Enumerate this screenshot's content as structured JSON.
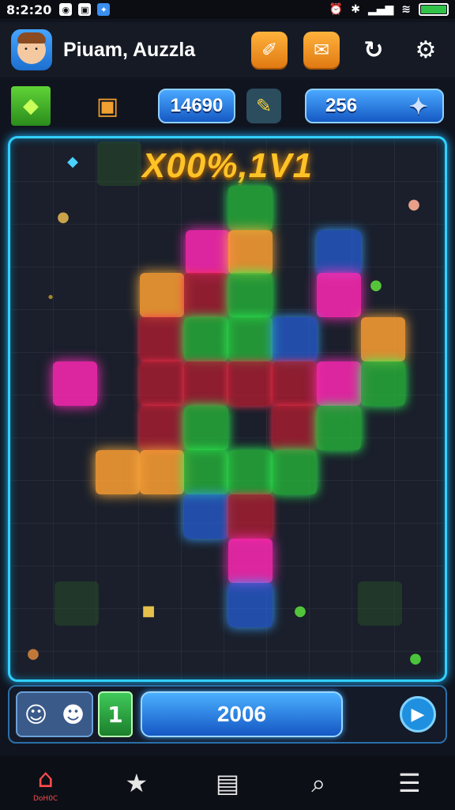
{
  "status_bar": {
    "time": "8:2:20",
    "icons": [
      "notification-icon",
      "image-icon",
      "app-icon"
    ],
    "right_icons": [
      "alarm-icon",
      "bluetooth-icon",
      "signal-icon",
      "wifi-icon",
      "battery-icon"
    ]
  },
  "header": {
    "title": "Piuam, Auzzla",
    "avatar_icon": "player-avatar",
    "buttons": [
      {
        "name": "hammer-icon",
        "glyph": "✐"
      },
      {
        "name": "mail-icon",
        "glyph": "✉"
      },
      {
        "name": "refresh-icon",
        "glyph": "↻"
      },
      {
        "name": "settings-icon",
        "glyph": "⚙"
      }
    ]
  },
  "resources": {
    "score": "14690",
    "gems": "256",
    "green_icon": "cube-icon",
    "chest_icon": "chest-icon",
    "tool_icon": "pencil-icon"
  },
  "board": {
    "combo_text": "X00%,1V1",
    "border_color": "#32d0ff"
  },
  "bottom_bar": {
    "level": "1",
    "progress_value": "2006",
    "friends_icons": [
      "friend-avatar-1",
      "friend-avatar-2"
    ],
    "play_icon": "play-icon"
  },
  "nav": {
    "items": [
      {
        "name": "home-icon",
        "glyph": "⌂",
        "label": "DoH0C"
      },
      {
        "name": "star-icon",
        "glyph": "★",
        "label": ""
      },
      {
        "name": "document-icon",
        "glyph": "▤",
        "label": ""
      },
      {
        "name": "search-icon",
        "glyph": "⌕",
        "label": ""
      },
      {
        "name": "list-icon",
        "glyph": "☰",
        "label": ""
      }
    ]
  }
}
